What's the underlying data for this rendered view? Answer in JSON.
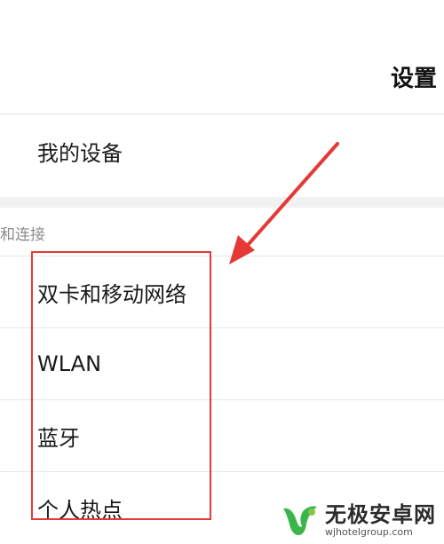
{
  "header": {
    "title": "设置"
  },
  "device_item": {
    "label": "我的设备"
  },
  "section": {
    "header": "和连接"
  },
  "network_items": [
    {
      "label": "双卡和移动网络"
    },
    {
      "label": "WLAN"
    },
    {
      "label": "蓝牙"
    },
    {
      "label": "个人热点"
    }
  ],
  "annotation": {
    "color": "#e53935"
  },
  "watermark": {
    "name": "无极安卓网",
    "url": "wjhotelgroup.com",
    "logo_icon": "wj-logo-icon"
  }
}
